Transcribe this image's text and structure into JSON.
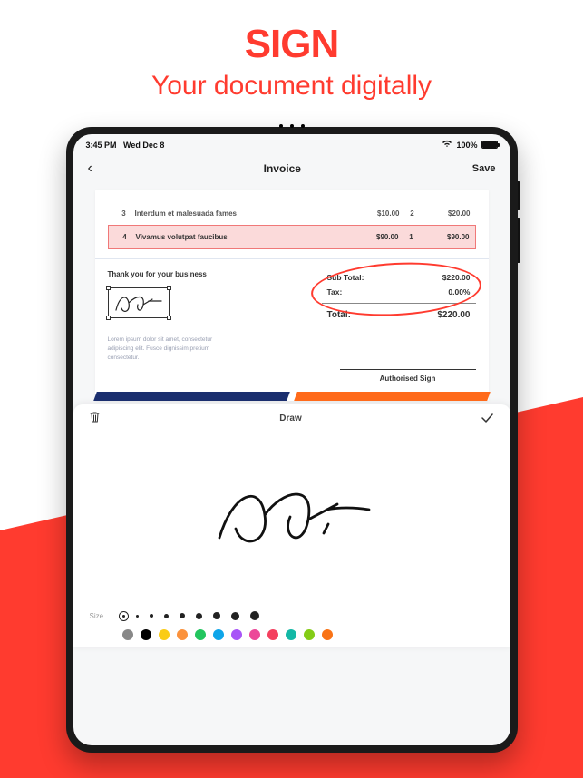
{
  "hero": {
    "title": "SIGN",
    "subtitle": "Your document digitally"
  },
  "statusbar": {
    "time": "3:45 PM",
    "date": "Wed Dec 8",
    "battery": "100%"
  },
  "navbar": {
    "title": "Invoice",
    "save": "Save"
  },
  "invoice": {
    "rows": [
      {
        "num": "3",
        "desc": "Interdum et malesuada fames",
        "price": "$10.00",
        "qty": "2",
        "total": "$20.00"
      },
      {
        "num": "4",
        "desc": "Vivamus volutpat faucibus",
        "price": "$90.00",
        "qty": "1",
        "total": "$90.00"
      }
    ],
    "thankyou": "Thank you for your business",
    "totals": {
      "subtotal_label": "Sub Total:",
      "subtotal": "$220.00",
      "tax_label": "Tax:",
      "tax": "0.00%",
      "total_label": "Total:",
      "total": "$220.00"
    },
    "lorem": "Lorem ipsum dolor sit amet, consectetur adipiscing elit. Fusce dignissim pretium consectetur.",
    "auth_sign": "Authorised Sign"
  },
  "draw": {
    "title": "Draw",
    "size_label": "Size"
  },
  "sizes": [
    3,
    3,
    4,
    5,
    6,
    7,
    8,
    9,
    10
  ],
  "colors": [
    "#888888",
    "#000000",
    "#facc15",
    "#fb923c",
    "#22c55e",
    "#0ea5e9",
    "#a855f7",
    "#ec4899",
    "#f43f5e",
    "#14b8a6",
    "#84cc16",
    "#f97316"
  ]
}
